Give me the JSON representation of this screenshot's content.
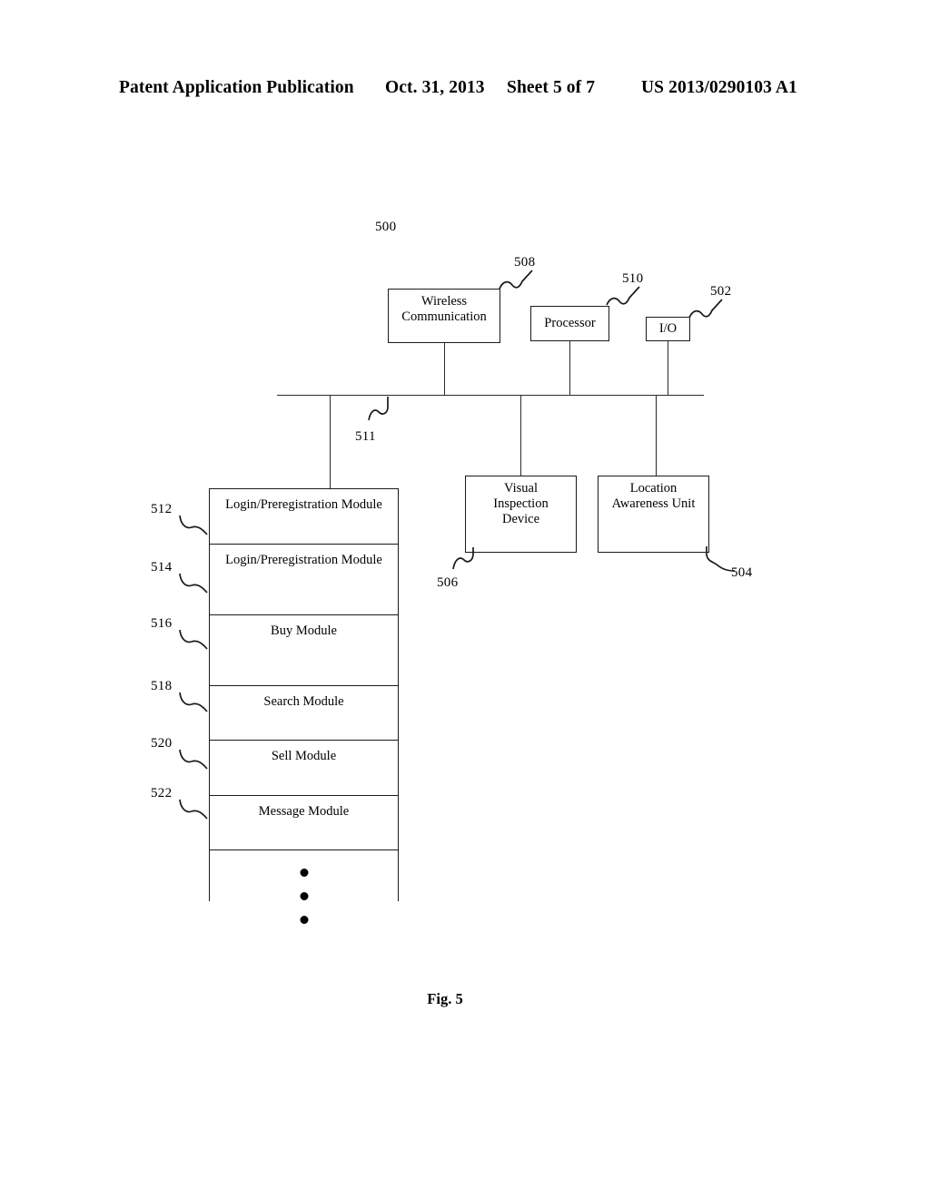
{
  "header": {
    "publication": "Patent Application Publication",
    "date": "Oct. 31, 2013",
    "sheet": "Sheet 5 of 7",
    "patent_number": "US 2013/0290103 A1"
  },
  "figure": {
    "caption": "Fig. 5",
    "system_ref": "500",
    "bus_ref": "511",
    "top_boxes": [
      {
        "label": "Wireless\nCommunication",
        "ref": "508"
      },
      {
        "label": "Processor",
        "ref": "510"
      },
      {
        "label": "I/O",
        "ref": "502"
      }
    ],
    "right_boxes": [
      {
        "label": "Visual\nInspection\nDevice",
        "ref": "506"
      },
      {
        "label": "Location\nAwareness Unit",
        "ref": "504"
      }
    ],
    "modules": [
      {
        "label": "Login/Preregistration Module",
        "ref": "512"
      },
      {
        "label": "Login/Preregistration Module",
        "ref": "514"
      },
      {
        "label": "Buy Module",
        "ref": "516"
      },
      {
        "label": "Search Module",
        "ref": "518"
      },
      {
        "label": "Sell Module",
        "ref": "520"
      },
      {
        "label": "Message Module",
        "ref": "522"
      }
    ],
    "ellipsis_dot_count": 3
  }
}
